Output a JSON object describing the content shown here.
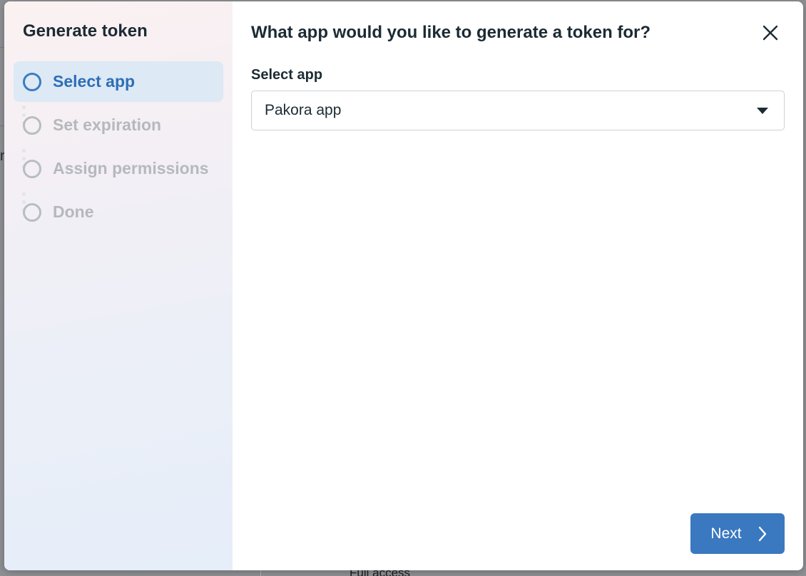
{
  "modal": {
    "stepper_title": "Generate token",
    "steps": [
      {
        "label": "Select app",
        "state": "active"
      },
      {
        "label": "Set expiration",
        "state": "inactive"
      },
      {
        "label": "Assign permissions",
        "state": "inactive"
      },
      {
        "label": "Done",
        "state": "inactive"
      }
    ],
    "question": "What app would you like to generate a token for?",
    "select_label": "Select app",
    "select_value": "Pakora app",
    "next_label": "Next",
    "close_icon": "close-icon",
    "next_icon": "chevron-right-icon",
    "select_icon": "caret-down-icon"
  },
  "background": {
    "footer_text": "Full access"
  },
  "colors": {
    "accent": "#3a78c0",
    "active_step_bg": "#dde9f5",
    "active_step_text": "#2e6fb6",
    "inactive_step": "#b5b9be",
    "heading": "#1c2b33"
  }
}
